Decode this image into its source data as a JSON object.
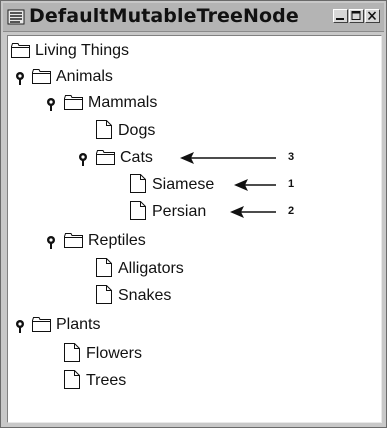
{
  "window": {
    "title": "DefaultMutableTreeNode"
  },
  "tree": {
    "root": "Living Things",
    "animals": "Animals",
    "mammals": "Mammals",
    "dogs": "Dogs",
    "cats": "Cats",
    "siamese": "Siamese",
    "persian": "Persian",
    "reptiles": "Reptiles",
    "alligators": "Alligators",
    "snakes": "Snakes",
    "plants": "Plants",
    "flowers": "Flowers",
    "trees": "Trees"
  },
  "callouts": {
    "cats": "3",
    "siamese": "1",
    "persian": "2"
  },
  "icons": {
    "folder": "folder-icon",
    "leaf": "document-icon",
    "expanded_handle": "expanded-handle-icon"
  }
}
